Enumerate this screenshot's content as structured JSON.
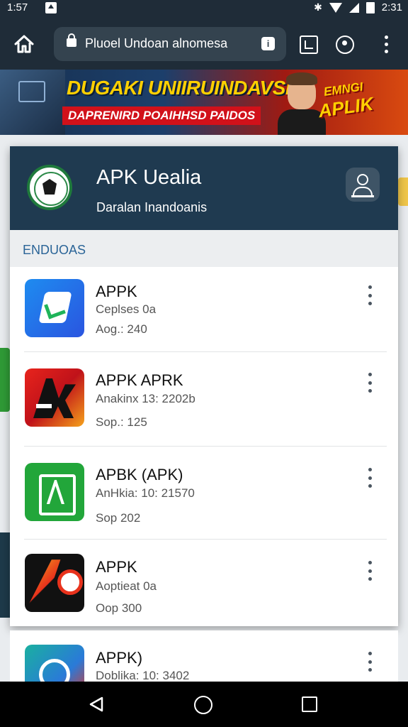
{
  "status_bar": {
    "time": "1:57",
    "clock_right": "2:31"
  },
  "browser": {
    "url": "Pluoel Undoan alnomesa",
    "info_badge": "i"
  },
  "banner": {
    "headline": "DUGAKI UNIIRUINDAVSIA",
    "subline": "DAPRENIRD POAIHHSD PAIDOS",
    "cta_line1": "EMNGI",
    "cta_line2": "APLIK"
  },
  "card": {
    "title": "APK Uealia",
    "subtitle": "Daralan Inandoanis",
    "section_label": "ENDUOAS",
    "apps": [
      {
        "name": "APPK",
        "meta1": "Ceplses 0a",
        "meta2": "Aog.: 240",
        "icon": "blue-document-app-icon"
      },
      {
        "name": "APPK APRK",
        "meta1": "Anakinx 13: 2202b",
        "meta2": "Sop.: 125",
        "icon": "red-ak-logo-icon"
      },
      {
        "name": "APBK (APK)",
        "meta1": "AnHkia: 10: 21570",
        "meta2": "Sop 202",
        "icon": "green-a-logo-icon"
      },
      {
        "name": "APPK",
        "meta1": "Aoptieat 0a",
        "meta2": "Oop 300",
        "icon": "black-red-swirl-icon"
      },
      {
        "name": "APPK)",
        "meta1": "Doblika: 10: 3402",
        "meta2": "",
        "icon": "teal-orb-icon"
      }
    ]
  },
  "colors": {
    "header_bg": "#1f3a50",
    "section_text": "#2a6497",
    "card_bg": "#ffffff",
    "status_bg": "#1f2c38"
  }
}
